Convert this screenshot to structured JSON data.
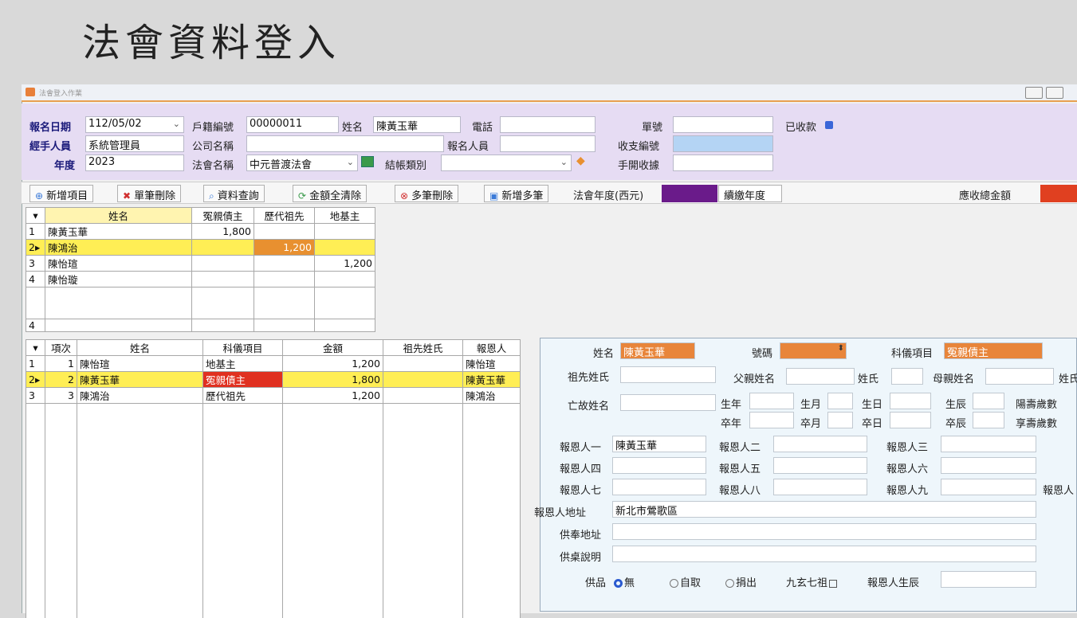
{
  "page_title": "法會資料登入",
  "window": {
    "title": "法會登入作業"
  },
  "form": {
    "reg_date_label": "報名日期",
    "reg_date": "112/05/02",
    "handler_label": "經手人員",
    "handler": "系統管理員",
    "year_label": "年度",
    "year": "2023",
    "household_no_label": "戶籍編號",
    "household_no": "00000011",
    "name_label": "姓名",
    "name": "陳黃玉華",
    "phone_label": "電話",
    "phone": "",
    "company_label": "公司名稱",
    "company": "",
    "registrant_label": "報名人員",
    "registrant": "",
    "ceremony_label": "法會名稱",
    "ceremony": "中元普渡法會",
    "account_type_label": "結帳類別",
    "account_type": "",
    "order_no_label": "單號",
    "order_no": "",
    "payment_no_label": "收支編號",
    "payment_no": "",
    "manual_receipt_label": "手開收據",
    "manual_receipt": "",
    "paid_label": "已收款"
  },
  "toolbar": {
    "add_item": "新增項目",
    "delete_one": "單筆刪除",
    "query": "資料查詢",
    "clear_amount": "金額全清除",
    "delete_multi": "多筆刪除",
    "add_multi": "新增多筆",
    "ceremony_year": "法會年度(西元)",
    "continue_year": "續繳年度",
    "total_due": "應收總金額"
  },
  "grid1": {
    "headers": [
      "姓名",
      "冤親債主",
      "歷代祖先",
      "地基主"
    ],
    "rows": [
      {
        "no": "1",
        "name": "陳黃玉華",
        "c1": "1,800",
        "c2": "",
        "c3": ""
      },
      {
        "no": "2▸",
        "name": "陳鴻治",
        "c1": "",
        "c2": "1,200",
        "c3": ""
      },
      {
        "no": "3",
        "name": "陳怡瑄",
        "c1": "",
        "c2": "",
        "c3": "1,200"
      },
      {
        "no": "4",
        "name": "陳怡璇",
        "c1": "",
        "c2": "",
        "c3": ""
      }
    ],
    "footer_count": "4"
  },
  "grid2": {
    "headers": [
      "項次",
      "姓名",
      "科儀項目",
      "金額",
      "祖先姓氏",
      "報恩人"
    ],
    "rows": [
      {
        "no": "1",
        "item": "1",
        "name": "陳怡瑄",
        "ritual": "地基主",
        "amount": "1,200",
        "surname": "",
        "grateful": "陳怡瑄"
      },
      {
        "no": "2▸",
        "item": "2",
        "name": "陳黃玉華",
        "ritual": "冤親債主",
        "amount": "1,800",
        "surname": "",
        "grateful": "陳黃玉華"
      },
      {
        "no": "3",
        "item": "3",
        "name": "陳鴻治",
        "ritual": "歷代祖先",
        "amount": "1,200",
        "surname": "",
        "grateful": "陳鴻治"
      }
    ]
  },
  "detail": {
    "name_label": "姓名",
    "name": "陳黃玉華",
    "number_label": "號碼",
    "number": "",
    "ritual_label": "科儀項目",
    "ritual": "冤親債主",
    "ancestor_surname_label": "祖先姓氏",
    "father_label": "父親姓名",
    "surname_label": "姓氏",
    "mother_label": "母親姓名",
    "surname2_label": "姓氏",
    "deceased_label": "亡故姓名",
    "birth_year": "生年",
    "birth_month": "生月",
    "birth_day": "生日",
    "birth_hour": "生辰",
    "life_years": "陽壽歲數",
    "death_year": "卒年",
    "death_month": "卒月",
    "death_day": "卒日",
    "death_hour": "卒辰",
    "age_years": "享壽歲數",
    "g1_label": "報恩人一",
    "g1": "陳黃玉華",
    "g2_label": "報恩人二",
    "g3_label": "報恩人三",
    "g4_label": "報恩人四",
    "g5_label": "報恩人五",
    "g6_label": "報恩人六",
    "g7_label": "報恩人七",
    "g8_label": "報恩人八",
    "g9_label": "報恩人九",
    "g10_label": "報恩人",
    "address_label": "報恩人地址",
    "address": "新北市鶯歌區",
    "worship_label": "供奉地址",
    "table_label": "供桌說明",
    "offering_label": "供品",
    "opt_none": "無",
    "opt_self": "自取",
    "opt_donate": "捐出",
    "nine_label": "九玄七祖",
    "birth_label": "報恩人生辰"
  }
}
